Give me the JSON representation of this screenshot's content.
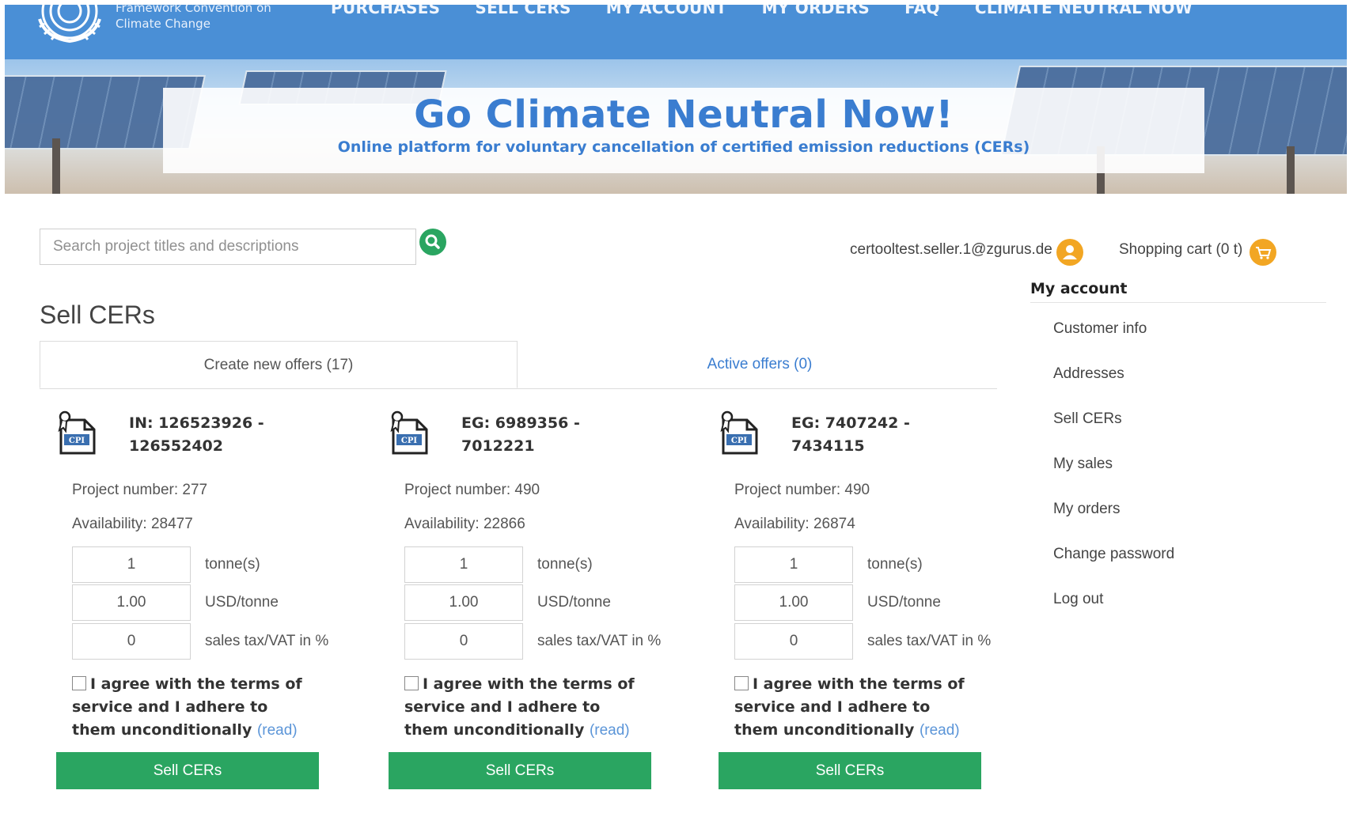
{
  "header": {
    "logo_text_line1": "Framework Convention on",
    "logo_text_line2": "Climate Change",
    "nav": [
      "PURCHASES",
      "SELL CERS",
      "MY ACCOUNT",
      "MY ORDERS",
      "FAQ",
      "CLIMATE NEUTRAL NOW"
    ]
  },
  "hero": {
    "title": "Go Climate Neutral Now!",
    "subtitle": "Online platform for voluntary cancellation of certified emission reductions (CERs)"
  },
  "search": {
    "placeholder": "Search project titles and descriptions",
    "icon": "search-icon"
  },
  "user": {
    "email": "certooltest.seller.1@zgurus.de",
    "icon": "user-icon"
  },
  "cart": {
    "label": "Shopping cart (0 t)",
    "icon": "cart-icon"
  },
  "colors": {
    "brand_blue": "#4a8fd6",
    "link_blue": "#3a7dd0",
    "green": "#2aa561",
    "orange": "#f2a623"
  },
  "page": {
    "title": "Sell CERs"
  },
  "tabs": {
    "active": "Create new offers (17)",
    "inactive": "Active offers (0)"
  },
  "sidebar": {
    "title": "My account",
    "items": [
      "Customer info",
      "Addresses",
      "Sell CERs",
      "My sales",
      "My orders",
      "Change password",
      "Log out"
    ]
  },
  "offers": [
    {
      "title": "IN: 126523926 - 126552402",
      "project": "Project number: 277",
      "availability": "Availability: 28477",
      "quantity": "1",
      "price": "1.00",
      "tax": "0"
    },
    {
      "title": "EG: 6989356 - 7012221",
      "project": "Project number: 490",
      "availability": "Availability: 22866",
      "quantity": "1",
      "price": "1.00",
      "tax": "0"
    },
    {
      "title": "EG: 7407242 - 7434115",
      "project": "Project number: 490",
      "availability": "Availability: 26874",
      "quantity": "1",
      "price": "1.00",
      "tax": "0"
    }
  ],
  "labels": {
    "tonnes": "tonne(s)",
    "usd": "USD/tonne",
    "tax": "sales tax/VAT in %",
    "agree": "I agree with the terms of service and I adhere to them unconditionally",
    "read": "(read)",
    "sell_button": "Sell CERs",
    "cert_badge": "CPI"
  }
}
